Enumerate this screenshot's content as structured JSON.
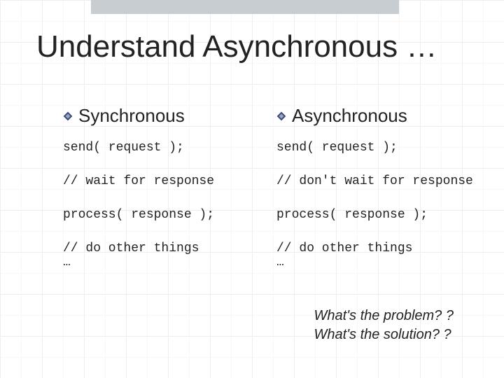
{
  "slide": {
    "title": "Understand Asynchronous …",
    "columns": [
      {
        "heading": "Synchronous",
        "code": {
          "l1": "send( request );",
          "l2": "// wait for response",
          "l3": "process( response );",
          "l4a": "// do other things",
          "l4b": "…"
        }
      },
      {
        "heading": "Asynchronous",
        "code": {
          "l1": "send( request );",
          "l2": "// don't wait for response",
          "l3": "process( response );",
          "l4a": "// do other things",
          "l4b": "…"
        }
      }
    ],
    "questions": {
      "q1": "What's the problem? ?",
      "q2": "What's the solution? ?"
    }
  }
}
